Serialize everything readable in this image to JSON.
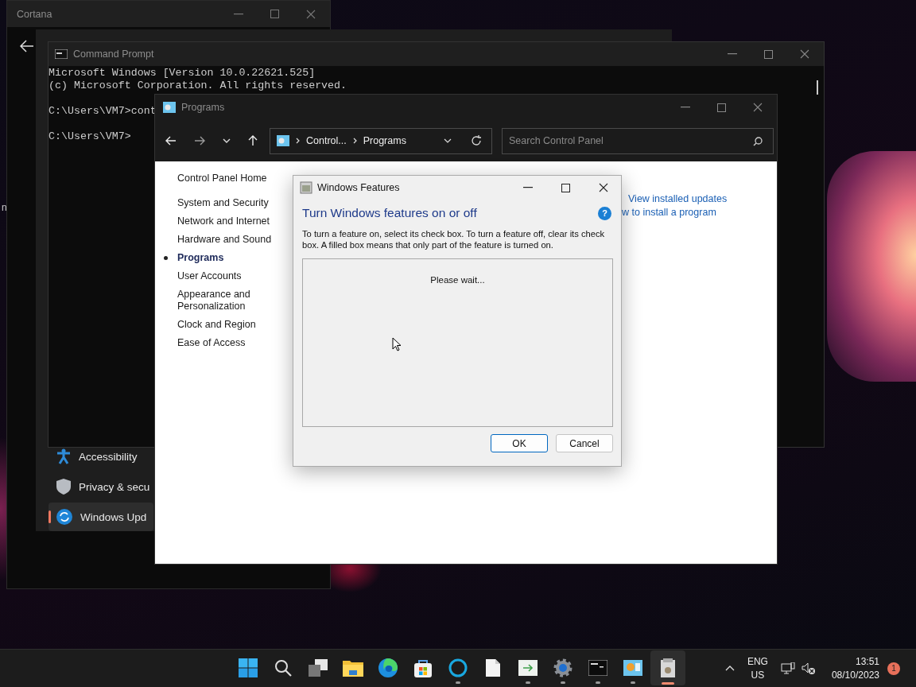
{
  "desktop_fragment": "n",
  "cortana_window": {
    "title": "Cortana"
  },
  "settings_window": {
    "nav_items": [
      {
        "label": "Accessibility",
        "kind": "accessibility",
        "selected": false
      },
      {
        "label": "Privacy & secu",
        "kind": "shield",
        "selected": false
      },
      {
        "label": "Windows Upd",
        "kind": "update",
        "selected": true
      }
    ]
  },
  "command_prompt": {
    "title": "Command Prompt",
    "blocks": [
      [
        "Microsoft Windows [Version 10.0.22621.525]",
        "(c) Microsoft Corporation. All rights reserved."
      ],
      [
        "C:\\Users\\VM7>cont"
      ],
      [
        "C:\\Users\\VM7>"
      ]
    ]
  },
  "programs_window": {
    "title": "Programs",
    "breadcrumb": [
      "Control...",
      "Programs"
    ],
    "search": {
      "placeholder": "Search Control Panel"
    },
    "home_link": "Control Panel Home",
    "sidebar": [
      {
        "label": "System and Security",
        "selected": false
      },
      {
        "label": "Network and Internet",
        "selected": false
      },
      {
        "label": "Hardware and Sound",
        "selected": false
      },
      {
        "label": "Programs",
        "selected": true
      },
      {
        "label": "User Accounts",
        "selected": false
      },
      {
        "label": "Appearance and Personalization",
        "selected": false
      },
      {
        "label": "Clock and Region",
        "selected": false
      },
      {
        "label": "Ease of Access",
        "selected": false
      }
    ],
    "links": [
      "View installed updates",
      "w to install a program"
    ]
  },
  "dialog": {
    "title": "Windows Features",
    "heading": "Turn Windows features on or off",
    "help": "?",
    "description": "To turn a feature on, select its check box. To turn a feature off, clear its check box. A filled box means that only part of the feature is turned on.",
    "status": "Please wait...",
    "buttons": [
      {
        "label": "OK",
        "default": true
      },
      {
        "label": "Cancel",
        "default": false
      }
    ]
  },
  "taskbar": {
    "apps": [
      {
        "kind": "start",
        "running": false,
        "active": false
      },
      {
        "kind": "search",
        "running": false,
        "active": false
      },
      {
        "kind": "task-view",
        "running": false,
        "active": false
      },
      {
        "kind": "folder",
        "running": false,
        "active": false
      },
      {
        "kind": "edge",
        "running": false,
        "active": false
      },
      {
        "kind": "store",
        "running": false,
        "active": false
      },
      {
        "kind": "ring",
        "running": true,
        "active": false
      },
      {
        "kind": "file",
        "running": false,
        "active": false
      },
      {
        "kind": "arrow",
        "running": true,
        "active": false
      },
      {
        "kind": "gear",
        "running": true,
        "active": false
      },
      {
        "kind": "terminal",
        "running": true,
        "active": false
      },
      {
        "kind": "control-panel",
        "running": true,
        "active": false
      },
      {
        "kind": "features",
        "running": true,
        "active": true
      }
    ],
    "language": [
      "ENG",
      "US"
    ],
    "time": "13:51",
    "date": "08/10/2023",
    "notifications": "1"
  }
}
